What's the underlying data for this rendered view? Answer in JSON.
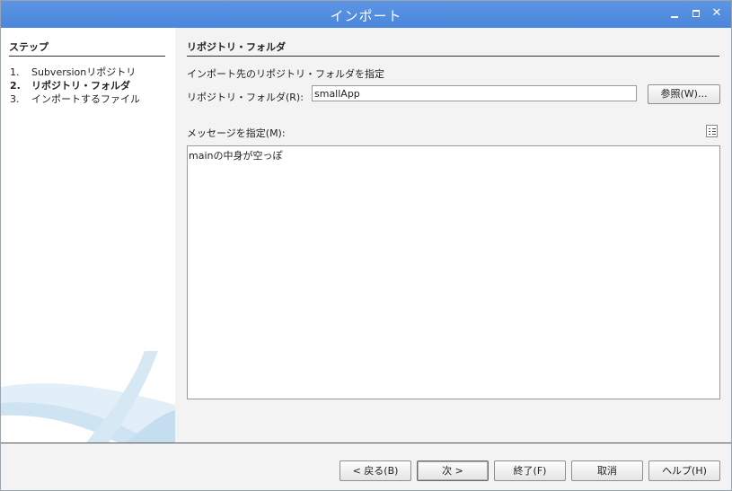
{
  "window": {
    "title": "インポート",
    "close_glyph": "✕"
  },
  "sidebar": {
    "header": "ステップ",
    "steps": [
      {
        "num": "1.",
        "label": "Subversionリポジトリ"
      },
      {
        "num": "2.",
        "label": "リポジトリ・フォルダ"
      },
      {
        "num": "3.",
        "label": "インポートするファイル"
      }
    ]
  },
  "main": {
    "section_title": "リポジトリ・フォルダ",
    "description": "インポート先のリポジトリ・フォルダを指定",
    "folder_label": "リポジトリ・フォルダ(R):",
    "folder_value": "smallApp",
    "browse_label": "参照(W)...",
    "message_label": "メッセージを指定(M):",
    "message_value": "mainの中身が空っぽ"
  },
  "footer": {
    "back_label": "< 戻る(B)",
    "next_label": "次 >",
    "finish_label": "終了(F)",
    "cancel_label": "取消",
    "help_label": "ヘルプ(H)"
  },
  "colors": {
    "titlebar": "#4a86dc",
    "panel": "#f3f3f3",
    "swoosh": "#cfe4f2"
  },
  "icons": {
    "window_controls": [
      "minimize-icon",
      "maximize-icon",
      "close-icon"
    ],
    "message_history": "history-list-icon"
  }
}
